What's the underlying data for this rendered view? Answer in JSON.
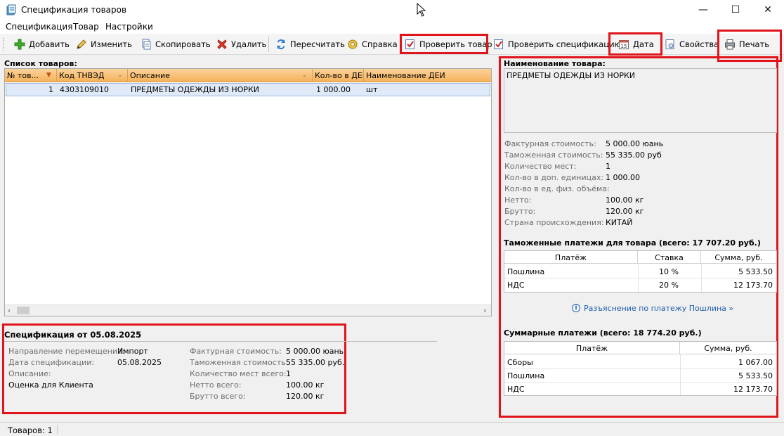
{
  "window": {
    "title": "Спецификация товаров",
    "minimize": "—",
    "maximize": "☐",
    "close": "✕"
  },
  "menu": [
    "Спецификация",
    "Товар",
    "Настройки"
  ],
  "toolbar": {
    "add": "Добавить",
    "edit": "Изменить",
    "copy": "Скопировать",
    "delete": "Удалить",
    "recalc": "Пересчитать",
    "help": "Справка",
    "check_item": "Проверить товар",
    "check_spec": "Проверить спецификацию",
    "date": "Дата",
    "props": "Свойства",
    "print": "Печать"
  },
  "goods": {
    "label": "Список товаров:",
    "columns": [
      "№ тов...",
      "Код ТНВЭД",
      "Описание",
      "Кол-во в ДЕИ",
      "Наименование ДЕИ"
    ],
    "rows": [
      {
        "num": "1",
        "code": "4303109010",
        "desc": "ПРЕДМЕТЫ ОДЕЖДЫ ИЗ НОРКИ",
        "qty": "1 000.00",
        "unit": "шт"
      }
    ]
  },
  "spec": {
    "title": "Спецификация от 05.08.2025",
    "direction_label": "Направление перемещения:",
    "direction": "Импорт",
    "date_label": "Дата спецификации:",
    "date": "05.08.2025",
    "desc_label": "Описание:",
    "desc": "Оценка для Клиента",
    "invoice_label": "Фактурная стоимость:",
    "invoice": "5 000.00 юань",
    "customs_label": "Таможенная стоимость:",
    "customs": "55 335.00 руб.",
    "places_label": "Количество мест всего:",
    "places": "1",
    "net_label": "Нетто всего:",
    "net": "100.00 кг",
    "gross_label": "Брутто всего:",
    "gross": "120.00 кг"
  },
  "item": {
    "name_label": "Наименование товара:",
    "name": "ПРЕДМЕТЫ ОДЕЖДЫ ИЗ НОРКИ",
    "props": [
      {
        "label": "Фактурная стоимость:",
        "value": "5 000.00 юань"
      },
      {
        "label": "Таможенная стоимость:",
        "value": "55 335.00 руб"
      },
      {
        "label": "Количество мест:",
        "value": "1"
      },
      {
        "label": "Кол-во в доп. единицах:",
        "value": "1 000.00"
      },
      {
        "label": "Кол-во в ед. физ. объёма:",
        "value": ""
      },
      {
        "label": "Нетто:",
        "value": "100.00 кг"
      },
      {
        "label": "Брутто:",
        "value": "120.00 кг"
      },
      {
        "label": "Страна происхождения:",
        "value": "КИТАЙ"
      }
    ]
  },
  "item_payments": {
    "title": "Таможенные платежи для товара (всего: 17 707.20 руб.)",
    "headers": [
      "Платёж",
      "Ставка",
      "Сумма, руб."
    ],
    "rows": [
      {
        "name": "Пошлина",
        "rate": "10 %",
        "sum": "5 533.50"
      },
      {
        "name": "НДС",
        "rate": "20 %",
        "sum": "12 173.70"
      }
    ]
  },
  "explain_link": "Разъяснение по платежу Пошлина »",
  "total_payments": {
    "title": "Суммарные платежи (всего:  18 774.20 руб.)",
    "headers": [
      "Платёж",
      "Сумма, руб."
    ],
    "rows": [
      {
        "name": "Сборы",
        "sum": "1 067.00"
      },
      {
        "name": "Пошлина",
        "sum": "5 533.50"
      },
      {
        "name": "НДС",
        "sum": "12 173.70"
      }
    ]
  },
  "status": {
    "count": "Товаров: 1"
  }
}
